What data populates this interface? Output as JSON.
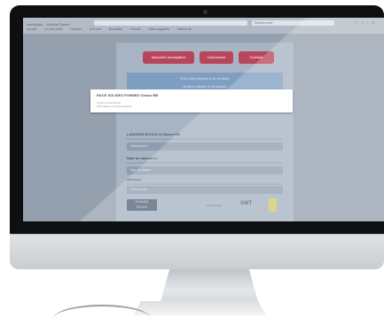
{
  "browser": {
    "window_title": "Inscription – Mozilla Firefox",
    "url": "",
    "search_placeholder": "Rechercher",
    "bookmarks": [
      "Accueil",
      "Le plus visité",
      "Débuter",
      "À la une",
      "Nouvelles",
      "Favoris",
      "Sites suggérés",
      "Galerie de"
    ]
  },
  "page": {
    "buttons": [
      "Nouvelle inscription",
      "Connexion",
      "Contact"
    ],
    "banner": [
      "Pour vous inscrire à un module,",
      "veuillez remplir le formulaire"
    ],
    "card": {
      "title": "RACE SOLIDES FORMES Classe BB",
      "line1": "Coupon d'inscription",
      "line2": "Informations complémentaires"
    },
    "section1": "LANGUES ÉCOLE et Classe BB",
    "field1": "Sélectionner",
    "section2": "Date de naissance",
    "field2": "Nom du parent",
    "section3": "Adresse",
    "field3": "Code postal",
    "logo_text": [
      "GRANDE",
      "ÉCOLE"
    ],
    "sponsor_caption": "Propulsé par",
    "sponsor_logo": "SWT"
  }
}
